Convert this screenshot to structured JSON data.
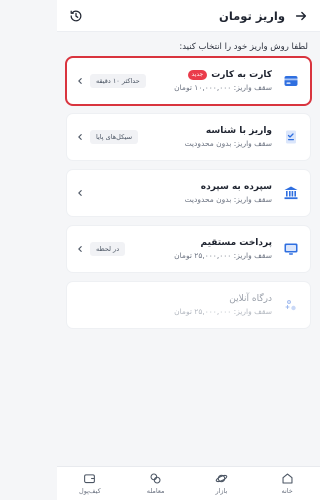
{
  "header": {
    "title": "واریز تومان",
    "back_icon": "arrow-right-icon",
    "history_icon": "history-icon"
  },
  "subtitle": "لطفا روش واریز خود را انتخاب کنید:",
  "colors": {
    "accent": "#2f6fe0",
    "selected_border": "#d9343e",
    "badge": "#ea3b4b"
  },
  "methods": [
    {
      "name": "کارت به کارت",
      "badge": "جدید",
      "limit": "سقف واریز: ۱۰,۰۰۰,۰۰۰ تومان",
      "tag": "حداکثر ۱۰ دقیقه",
      "icon": "card-icon"
    },
    {
      "name": "واریز با شناسه",
      "limit": "سقف واریز: بدون محدودیت",
      "tag": "سیکل‌های پایا",
      "icon": "id-document-icon"
    },
    {
      "name": "سپرده به سپرده",
      "limit": "سقف واریز: بدون محدودیت",
      "tag": "",
      "icon": "bank-icon"
    },
    {
      "name": "پرداخت مستقیم",
      "limit": "سقف واریز: ۲۵,۰۰۰,۰۰۰ تومان",
      "tag": "در لحظه",
      "icon": "monitor-icon"
    },
    {
      "name": "درگاه آنلاین",
      "limit": "سقف واریز: ۲۵,۰۰۰,۰۰۰ تومان",
      "tag": "",
      "icon": "gateway-icon"
    }
  ],
  "nav": {
    "home": "خانه",
    "market": "بازار",
    "trade": "معامله",
    "wallet": "کیف‌پول"
  }
}
